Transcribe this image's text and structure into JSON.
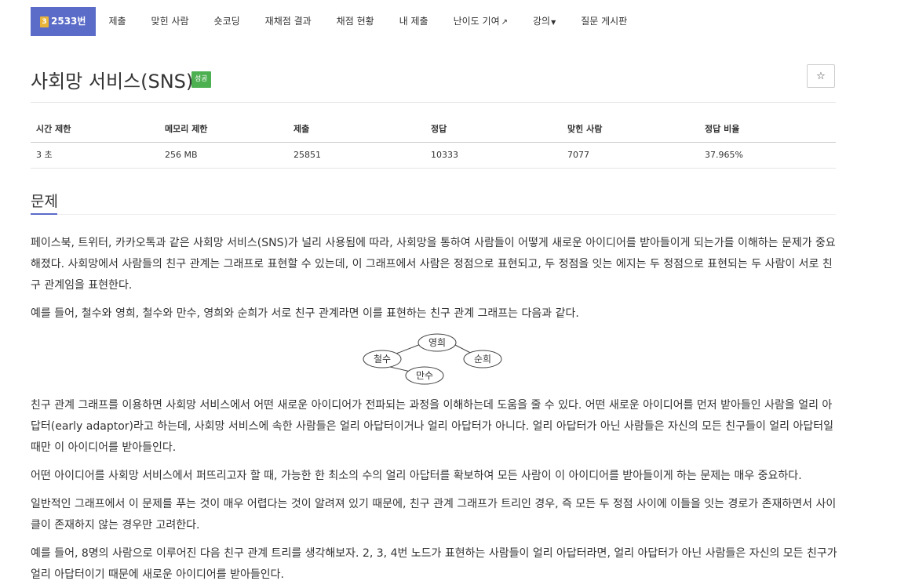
{
  "nav": {
    "problem_tier_icon": "tier-bronze-3",
    "tier_label": "3",
    "problem_number": "2533번",
    "items": [
      {
        "label": "제출"
      },
      {
        "label": "맞힌 사람"
      },
      {
        "label": "숏코딩"
      },
      {
        "label": "재채점 결과"
      },
      {
        "label": "채점 현황"
      },
      {
        "label": "내 제출"
      },
      {
        "label": "난이도 기여"
      },
      {
        "label": "강의"
      },
      {
        "label": "질문 게시판"
      }
    ]
  },
  "problem": {
    "title": "사회망 서비스(SNS)",
    "status_badge": "성공",
    "star_icon": "☆"
  },
  "stats": {
    "headers": [
      "시간 제한",
      "메모리 제한",
      "제출",
      "정답",
      "맞힌 사람",
      "정답 비율"
    ],
    "values": [
      "3 초",
      "256 MB",
      "25851",
      "10333",
      "7077",
      "37.965%"
    ]
  },
  "section": {
    "title": "문제",
    "paragraphs": [
      "페이스북, 트위터, 카카오톡과 같은 사회망 서비스(SNS)가 널리 사용됨에 따라, 사회망을 통하여 사람들이 어떻게 새로운 아이디어를 받아들이게 되는가를 이해하는 문제가 중요해졌다. 사회망에서 사람들의 친구 관계는 그래프로 표현할 수 있는데,  이 그래프에서 사람은 정점으로 표현되고, 두 정점을 잇는 에지는 두 정점으로 표현되는 두 사람이 서로 친구 관계임을 표현한다.",
      "예를 들어, 철수와 영희, 철수와 만수, 영희와 순희가 서로 친구 관계라면 이를 표현하는 친구 관계 그래프는 다음과 같다.",
      "친구 관계 그래프를 이용하면 사회망 서비스에서 어떤 새로운 아이디어가 전파되는 과정을 이해하는데 도움을 줄 수 있다. 어떤 새로운 아이디어를 먼저 받아들인 사람을 얼리 아답터(early adaptor)라고 하는데, 사회망 서비스에 속한 사람들은 얼리 아답터이거나 얼리 아답터가 아니다. 얼리 아답터가 아닌 사람들은 자신의 모든 친구들이 얼리 아답터일 때만 이 아이디어를 받아들인다.",
      "어떤 아이디어를 사회망 서비스에서 퍼뜨리고자 할 때, 가능한 한 최소의 수의 얼리 아답터를 확보하여 모든 사람이 이 아이디어를 받아들이게 하는  문제는 매우 중요하다.",
      "일반적인 그래프에서 이 문제를 푸는 것이 매우 어렵다는 것이 알려져 있기 때문에, 친구 관계 그래프가 트리인 경우, 즉 모든 두 정점 사이에 이들을 잇는 경로가 존재하면서 사이클이 존재하지 않는 경우만 고려한다.",
      "예를 들어, 8명의 사람으로 이루어진 다음 친구 관계 트리를 생각해보자. 2, 3, 4번 노드가 표현하는 사람들이 얼리 아답터라면, 얼리 아답터가 아닌 사람들은 자신의 모든 친구가 얼리 아답터이기 때문에 새로운 아이디어를 받아들인다."
    ]
  },
  "graph": {
    "nodes": [
      "영희",
      "철수",
      "순희",
      "만수"
    ]
  }
}
